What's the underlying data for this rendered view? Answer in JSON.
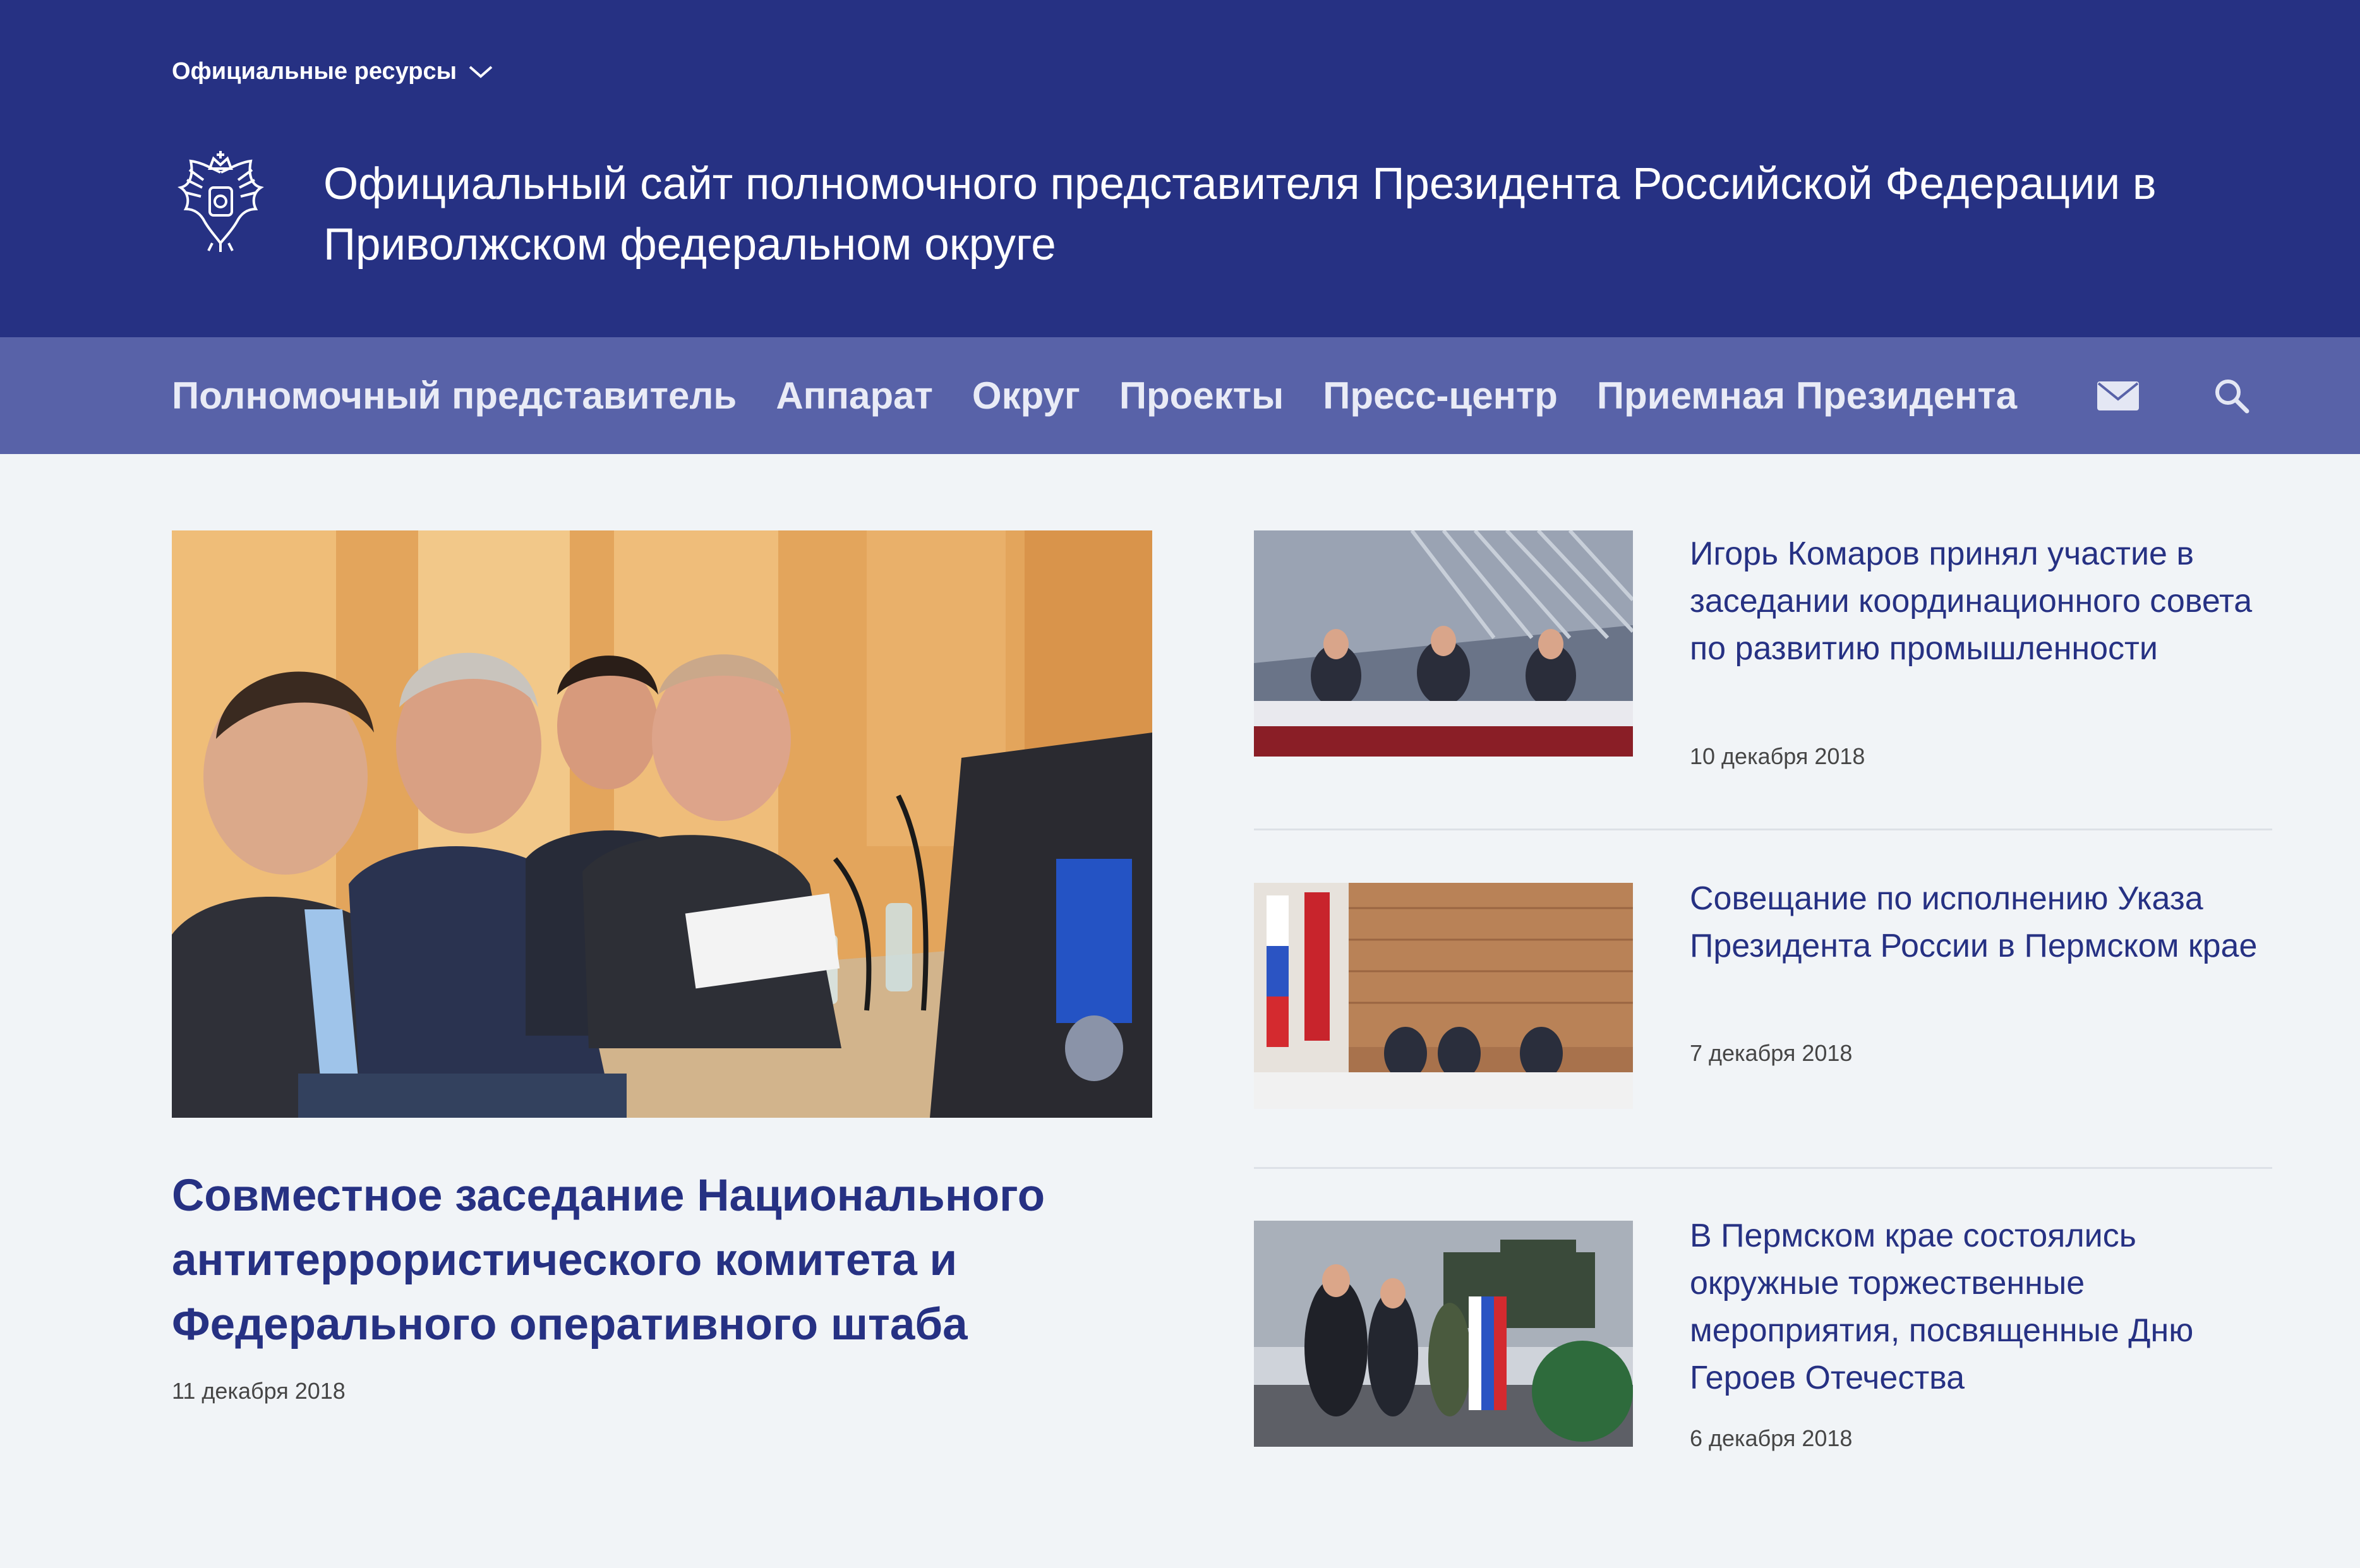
{
  "header": {
    "resources_label": "Официальные ресурсы",
    "site_title": "Официальный сайт полномочного представителя Президента Российской Федерации в Приволжском федеральном округе"
  },
  "nav": {
    "items": [
      {
        "label": "Полномочный представитель"
      },
      {
        "label": "Аппарат"
      },
      {
        "label": "Округ"
      },
      {
        "label": "Проекты"
      },
      {
        "label": "Пресс-центр"
      },
      {
        "label": "Приемная Президента"
      }
    ],
    "icons": [
      "mail-icon",
      "search-icon"
    ]
  },
  "featured": {
    "title": "Совместное заседание Национального антитеррористического комитета и Федерального оперативного штаба",
    "date": "11 декабря 2018"
  },
  "news": [
    {
      "title": "Игорь Комаров принял участие в заседании координационного совета по развитию промышленности",
      "date": "10 декабря 2018"
    },
    {
      "title": "Совещание по исполнению Указа Президента России в Пермском крае",
      "date": "7 декабря 2018"
    },
    {
      "title": "В Пермском крае состоялись окружные торжественные мероприятия, посвященные Дню Героев Отечества",
      "date": "6 декабря 2018"
    }
  ],
  "colors": {
    "header_bg": "#263183",
    "nav_bg": "#5862a8",
    "page_bg": "#f1f4f7",
    "link": "#263183"
  }
}
